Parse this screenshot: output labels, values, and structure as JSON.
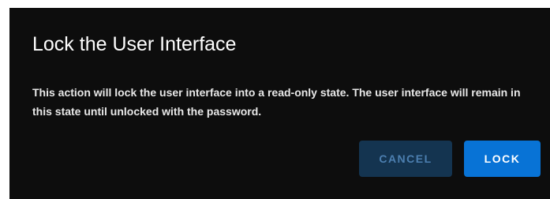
{
  "dialog": {
    "title": "Lock the User Interface",
    "message": "This action will lock the user interface into a read-only state. The user interface will remain in this state until unlocked with the password.",
    "cancel_label": "CANCEL",
    "lock_label": "LOCK"
  },
  "colors": {
    "dialog_background": "#0d0d0d",
    "cancel_background": "#143450",
    "cancel_text": "#4c7fb0",
    "lock_background": "#0873d6",
    "lock_text": "#ffffff"
  }
}
